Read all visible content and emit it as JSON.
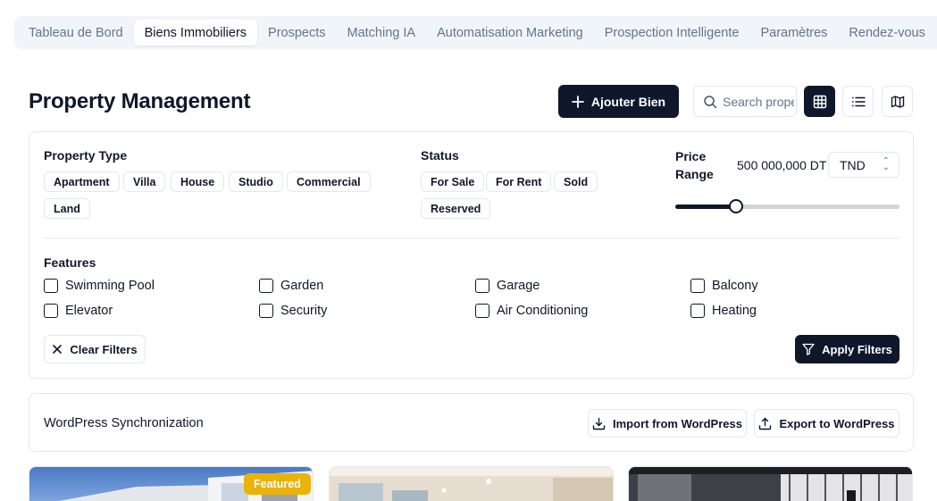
{
  "tabs": [
    {
      "label": "Tableau de Bord",
      "active": false
    },
    {
      "label": "Biens Immobiliers",
      "active": true
    },
    {
      "label": "Prospects",
      "active": false
    },
    {
      "label": "Matching IA",
      "active": false
    },
    {
      "label": "Automatisation Marketing",
      "active": false
    },
    {
      "label": "Prospection Intelligente",
      "active": false
    },
    {
      "label": "Paramètres",
      "active": false
    },
    {
      "label": "Rendez-vous",
      "active": false
    }
  ],
  "header": {
    "title": "Property Management",
    "add_button": "Ajouter Bien",
    "search_placeholder": "Search properties...",
    "active_view": "grid"
  },
  "filters": {
    "property_type": {
      "label": "Property Type",
      "options": [
        "Apartment",
        "Villa",
        "House",
        "Studio",
        "Commercial",
        "Land"
      ]
    },
    "status": {
      "label": "Status",
      "options": [
        "For Sale",
        "For Rent",
        "Sold",
        "Reserved"
      ]
    },
    "price": {
      "label": "Price Range",
      "value": "500 000,000 DT",
      "currency": "TND",
      "slider_fraction": 0.27
    },
    "features": {
      "label": "Features",
      "items": [
        "Swimming Pool",
        "Garden",
        "Garage",
        "Balcony",
        "Elevator",
        "Security",
        "Air Conditioning",
        "Heating"
      ]
    },
    "clear_button": "Clear Filters",
    "apply_button": "Apply Filters"
  },
  "wordpress": {
    "title": "WordPress Synchronization",
    "import_button": "Import from WordPress",
    "export_button": "Export to WordPress"
  },
  "listings": [
    {
      "badge": "Featured"
    },
    {
      "badge": ""
    },
    {
      "badge": ""
    }
  ],
  "colors": {
    "primary": "#0f172a",
    "muted": "#64748b",
    "border": "#e2e8f0",
    "featured": "#eab308"
  }
}
